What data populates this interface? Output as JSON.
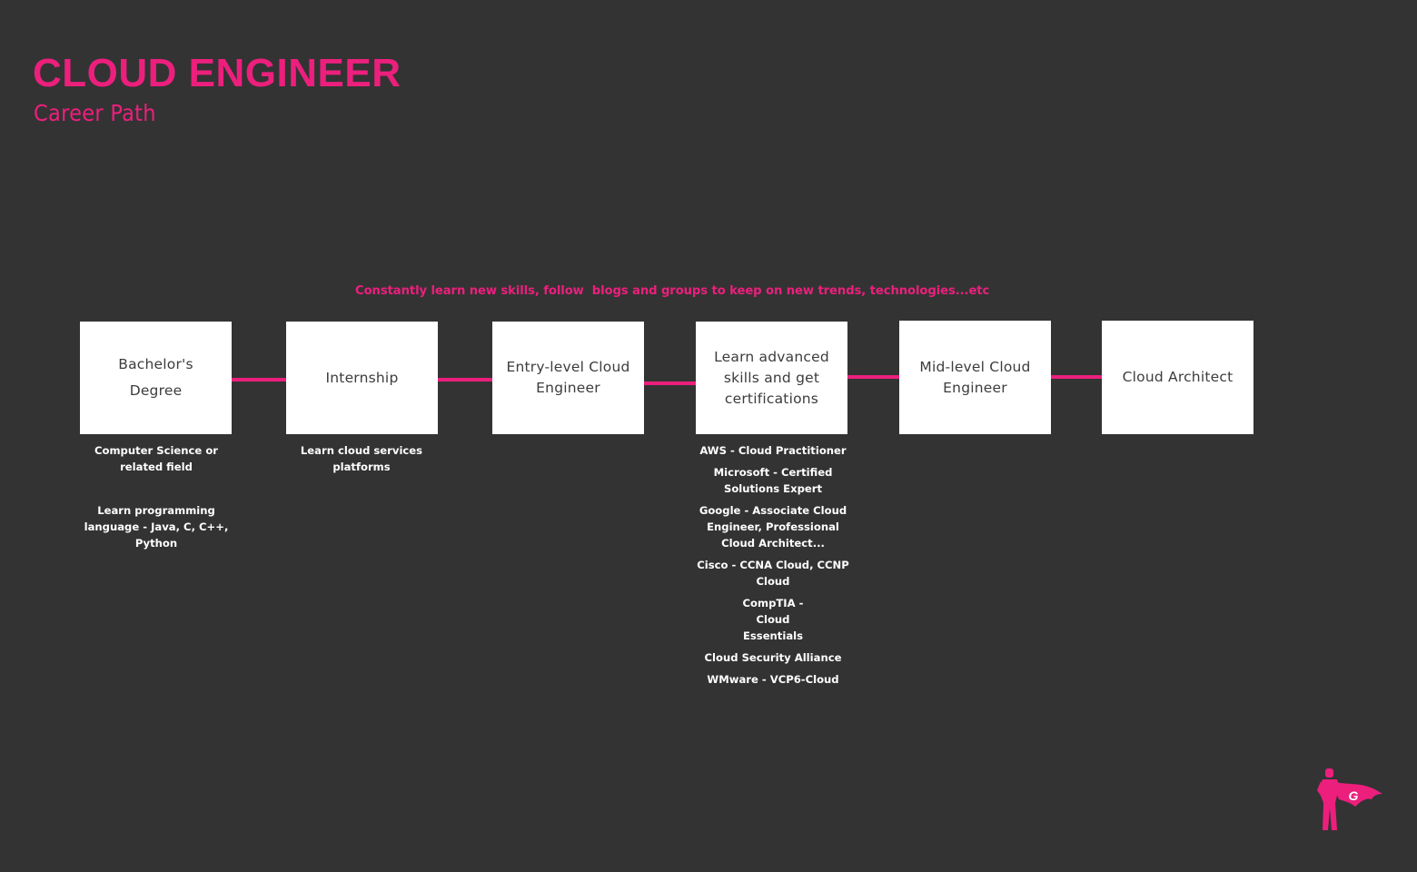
{
  "header": {
    "title": "CLOUD ENGINEER",
    "subtitle": "Career Path"
  },
  "banner": {
    "text": "Constantly learn new skills, follow  blogs and groups to keep on new trends, technologies...etc"
  },
  "colors": {
    "background": "#333333",
    "accent": "#ec1f7d",
    "box": "#ffffff",
    "box_text": "#3c3c3c",
    "note_text": "#ffffff"
  },
  "steps": [
    {
      "label": "Bachelor's Degree",
      "notes": [
        "Computer Science or related field",
        "Learn programming language - Java, C, C++, Python"
      ]
    },
    {
      "label": "Internship",
      "notes": [
        "Learn cloud services platforms"
      ]
    },
    {
      "label": "Entry-level Cloud Engineer",
      "notes": []
    },
    {
      "label": "Learn advanced skills and get certifications",
      "notes": [
        "AWS - Cloud Practitioner",
        "Microsoft - Certified Solutions Expert",
        "Google - Associate Cloud Engineer, Professional Cloud Architect...",
        "Cisco - CCNA Cloud, CCNP Cloud",
        "CompTIA - Cloud Essentials",
        "Cloud Security Alliance",
        "WMware - VCP6-Cloud"
      ]
    },
    {
      "label": "Mid-level Cloud Engineer",
      "notes": []
    },
    {
      "label": "Cloud Architect",
      "notes": []
    }
  ],
  "logo": {
    "icon": "superhero-logo-icon",
    "letter": "G"
  }
}
